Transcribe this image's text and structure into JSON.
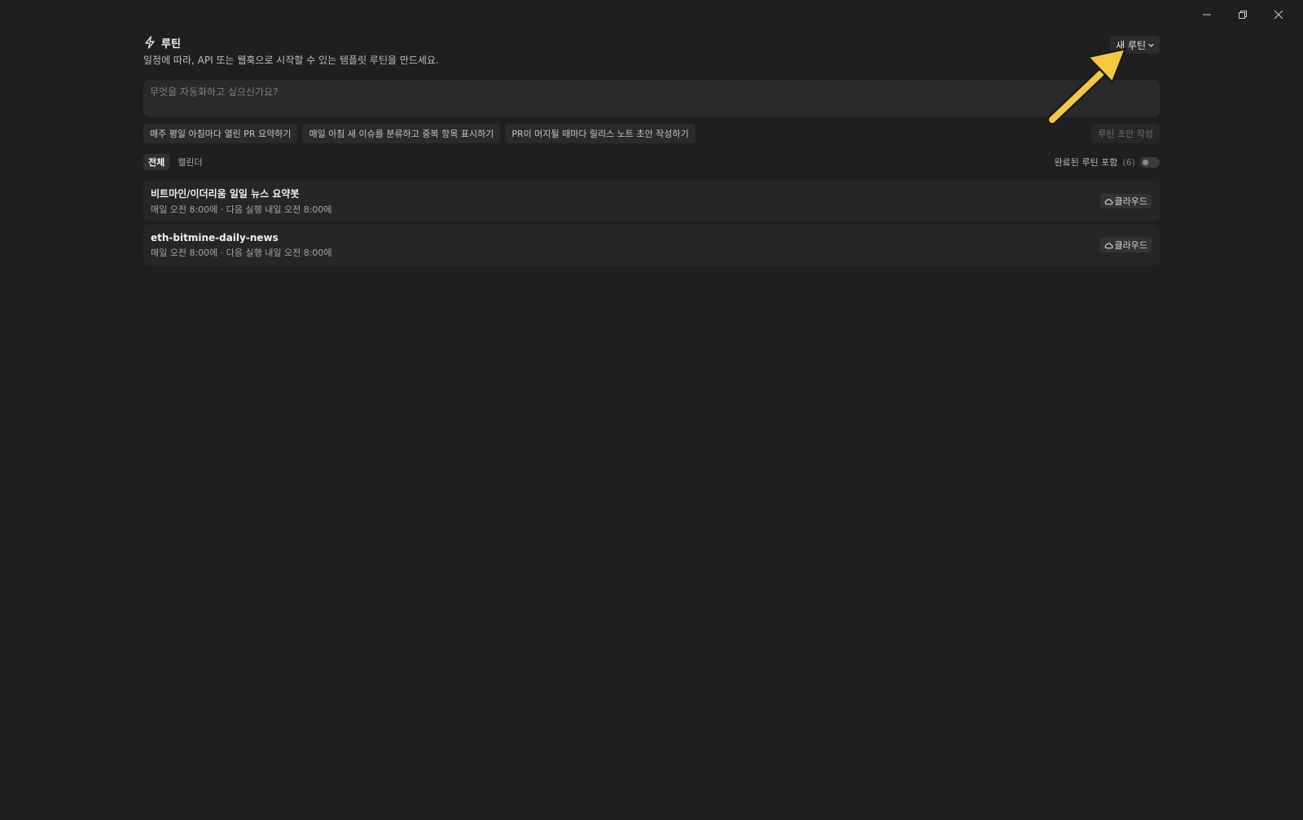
{
  "window": {
    "minimize_icon": "minimize-icon",
    "restore_icon": "restore-icon",
    "close_icon": "close-icon"
  },
  "header": {
    "icon": "lightning-icon",
    "title": "루틴",
    "subtitle": "일정에 따라, API 또는 웹훅으로 시작할 수 있는 템플릿 루틴을 만드세요.",
    "new_routine_label": "새 루틴"
  },
  "prompt": {
    "placeholder": "무엇을 자동화하고 싶으신가요?",
    "value": ""
  },
  "suggestions": [
    "매주 평일 아침마다 열린 PR 요약하기",
    "매일 아침 새 이슈를 분류하고 중복 항목 표시하기",
    "PR이 머지될 때마다 릴리스 노트 초안 작성하기"
  ],
  "draft_button_label": "루틴 초안 작성",
  "tabs": [
    {
      "label": "전체",
      "active": true
    },
    {
      "label": "캘린더",
      "active": false
    }
  ],
  "completed_filter": {
    "label": "완료된 루틴 포함",
    "count": "(6)",
    "enabled": false
  },
  "routines": [
    {
      "name": "비트마인/이더리움 일일 뉴스 요약봇",
      "schedule": "매일 오전 8:00에 · 다음 실행 내일 오전 8:00에",
      "badge": "클라우드"
    },
    {
      "name": "eth-bitmine-daily-news",
      "schedule": "매일 오전 8:00에 · 다음 실행 내일 오전 8:00에",
      "badge": "클라우드"
    }
  ],
  "annotation": {
    "color": "#f5c842"
  }
}
